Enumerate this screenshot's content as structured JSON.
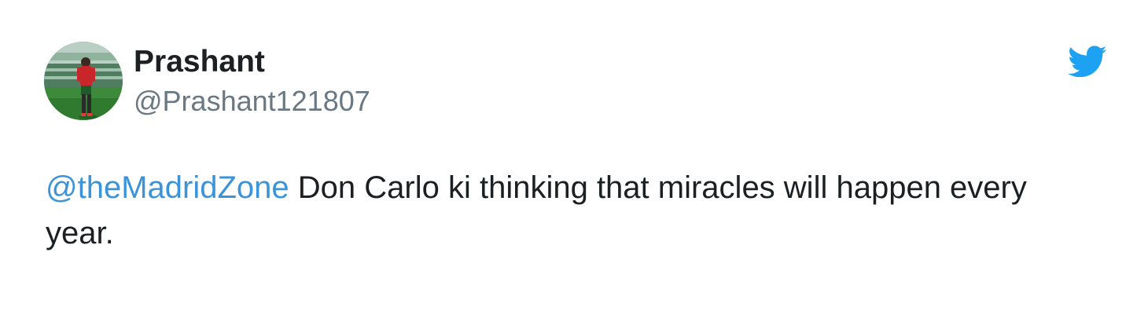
{
  "author": {
    "display_name": "Prashant",
    "handle": "@Prashant121807",
    "avatar": "avatar-football-player-on-pitch"
  },
  "brand": {
    "icon": "twitter-bird-icon",
    "color": "#1da1f2"
  },
  "tweet": {
    "mention": "@theMadridZone",
    "body": " Don Carlo ki thinking that miracles will happen every year."
  },
  "colors": {
    "text": "#1c2022",
    "secondary": "#697882",
    "link": "#3b94d9"
  }
}
